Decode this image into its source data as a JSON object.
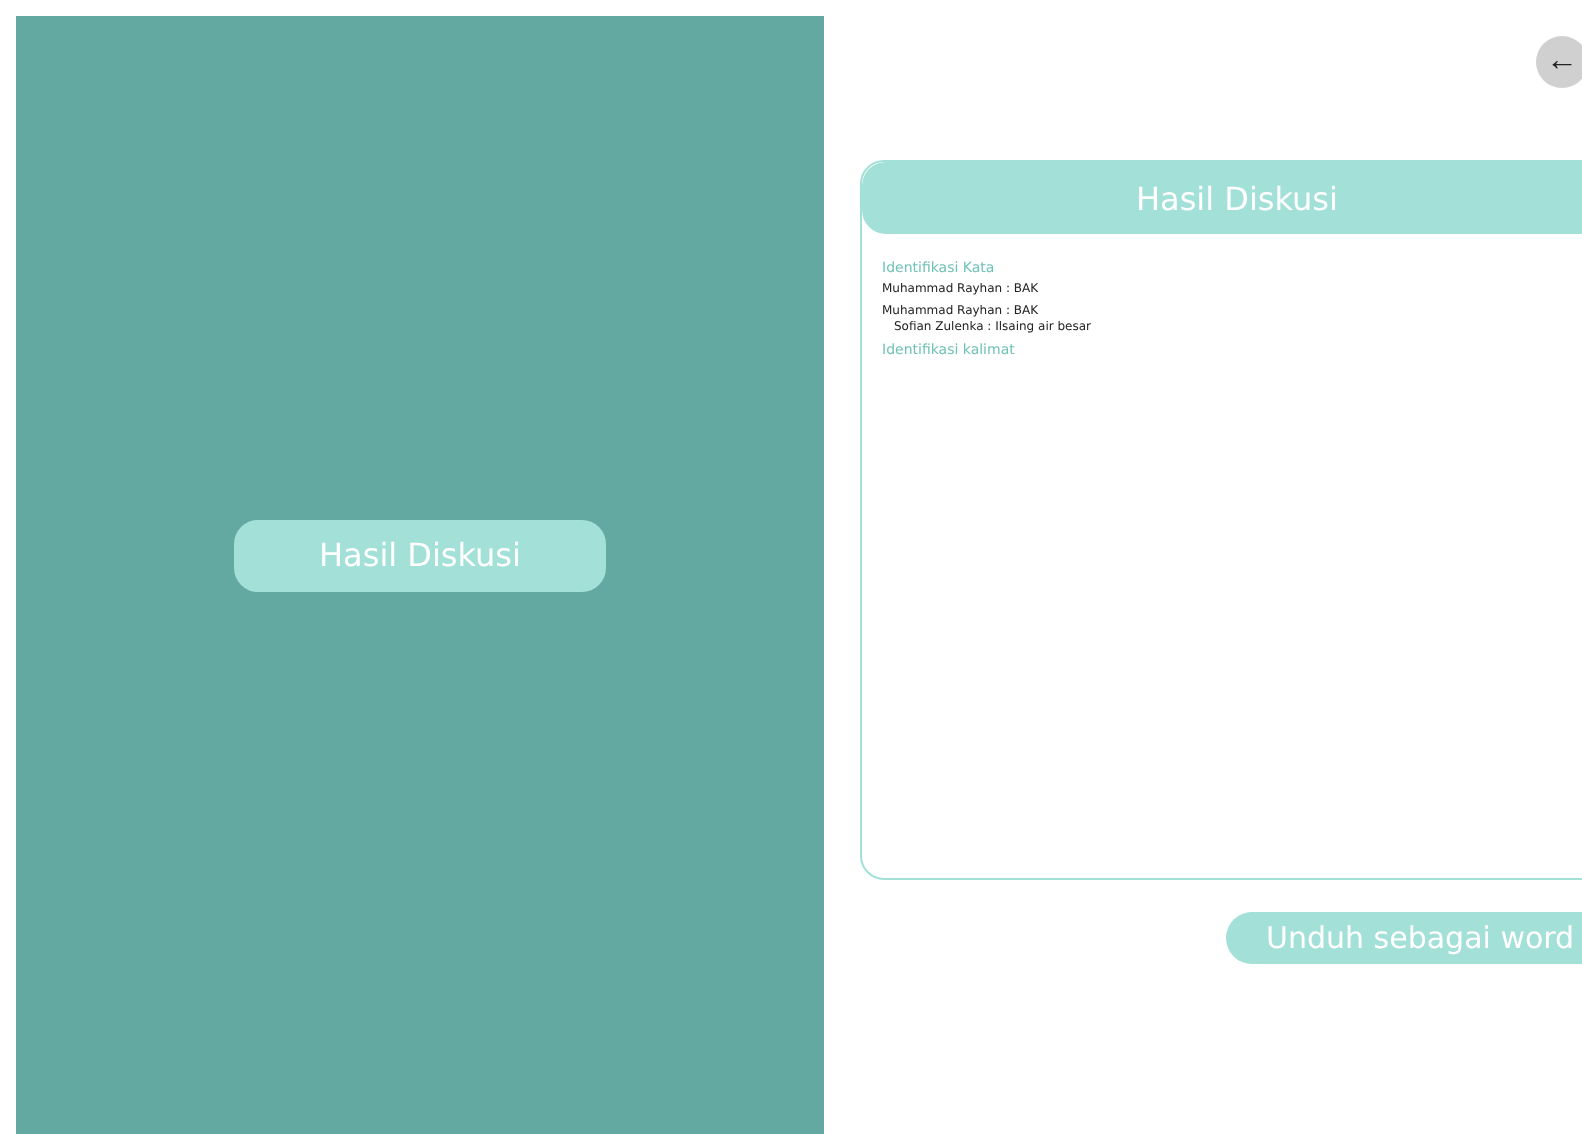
{
  "left_panel": {
    "button": "Hasil Diskusi"
  },
  "back_button": {
    "icon": "←"
  },
  "card": {
    "title": "Hasil Diskusi",
    "sections": [
      {
        "heading": "Identifikasi Kata",
        "entries": [
          {
            "text": "Muhammad Rayhan : BAK"
          },
          {
            "text": "Muhammad Rayhan : BAK",
            "children": [
              {
                "text": "Sofian Zulenka : Ilsaing air besar"
              }
            ]
          }
        ]
      },
      {
        "heading": "Identifikasi kalimat"
      }
    ]
  },
  "download_button": "Unduh sebagai word"
}
